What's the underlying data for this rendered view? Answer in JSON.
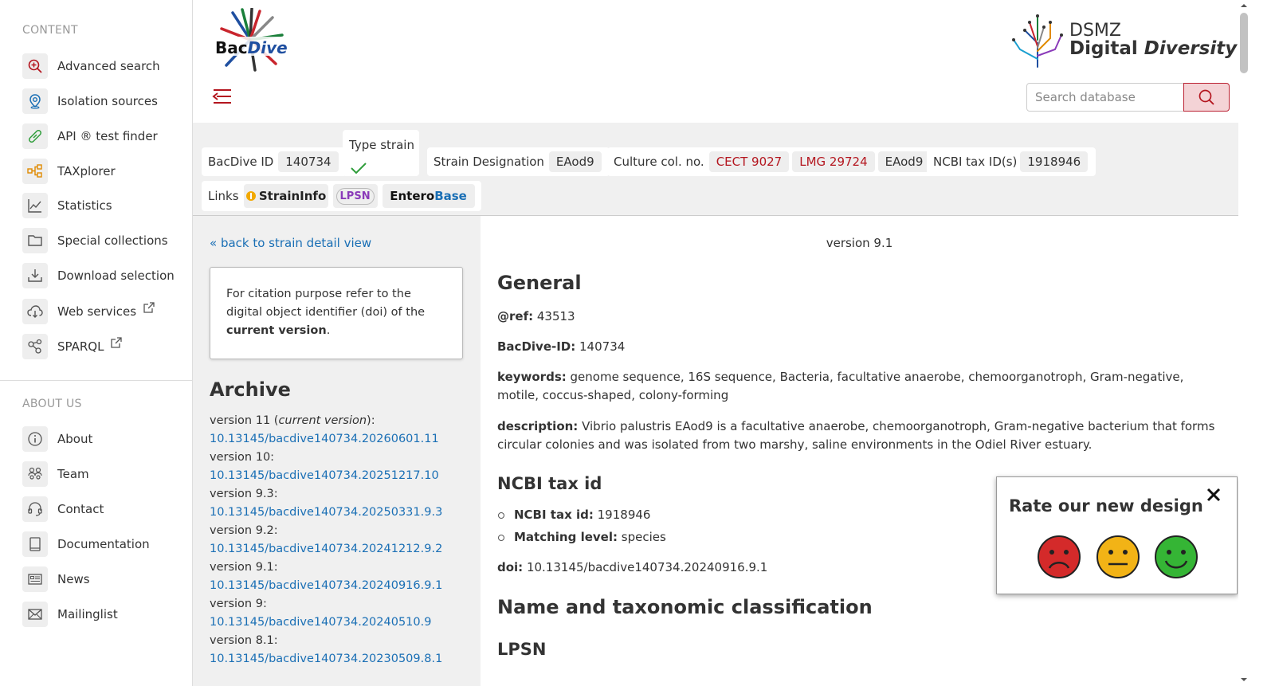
{
  "sidebar": {
    "content_heading": "CONTENT",
    "content_items": [
      {
        "label": "Advanced search",
        "icon": "search-plus-icon"
      },
      {
        "label": "Isolation sources",
        "icon": "map-pin-icon"
      },
      {
        "label": "API ® test finder",
        "icon": "test-tube-icon"
      },
      {
        "label": "TAXplorer",
        "icon": "tree-icon"
      },
      {
        "label": "Statistics",
        "icon": "line-chart-icon"
      },
      {
        "label": "Special collections",
        "icon": "folder-icon"
      },
      {
        "label": "Download selection",
        "icon": "download-icon"
      },
      {
        "label": "Web services",
        "icon": "cloud-download-icon",
        "external": true
      },
      {
        "label": "SPARQL",
        "icon": "share-nodes-icon",
        "external": true
      }
    ],
    "about_heading": "ABOUT US",
    "about_items": [
      {
        "label": "About",
        "icon": "info-icon"
      },
      {
        "label": "Team",
        "icon": "team-icon"
      },
      {
        "label": "Contact",
        "icon": "headset-icon"
      },
      {
        "label": "Documentation",
        "icon": "book-icon"
      },
      {
        "label": "News",
        "icon": "newspaper-icon"
      },
      {
        "label": "Mailinglist",
        "icon": "mail-icon"
      }
    ]
  },
  "header": {
    "logo_prefix": "Bac",
    "logo_suffix": "Dive",
    "dsmz_line1": "DSMZ",
    "dsmz_line2a": "Digital ",
    "dsmz_line2b": "Diversity",
    "search_placeholder": "Search database"
  },
  "infobar": {
    "bacdive_id_label": "BacDive ID",
    "bacdive_id": "140734",
    "type_strain_label": "Type strain",
    "strain_designation_label": "Strain Designation",
    "strain_designation": "EAod9",
    "culture_label": "Culture col. no.",
    "culture_numbers": [
      "CECT 9027",
      "LMG 29724",
      "EAod9"
    ],
    "ncbi_label": "NCBI tax ID(s)",
    "ncbi_id": "1918946",
    "links_label": "Links",
    "link_straininfo": "StrainInfo",
    "link_lpsn": "LPSN",
    "link_entero_a": "Entero",
    "link_entero_b": "Base"
  },
  "left": {
    "back_link": "« back to strain detail view",
    "cite_text_1": "For citation purpose refer to the digital object identifier (doi) of the ",
    "cite_bold": "current version",
    "cite_end": ".",
    "archive_title": "Archive",
    "archive": [
      {
        "version": "version 11 (",
        "current": "current version",
        "suffix": "):",
        "doi": "10.13145/bacdive140734.20260601.11"
      },
      {
        "version": "version 10:",
        "current": "",
        "suffix": "",
        "doi": "10.13145/bacdive140734.20251217.10"
      },
      {
        "version": "version 9.3:",
        "current": "",
        "suffix": "",
        "doi": "10.13145/bacdive140734.20250331.9.3"
      },
      {
        "version": "version 9.2:",
        "current": "",
        "suffix": "",
        "doi": "10.13145/bacdive140734.20241212.9.2"
      },
      {
        "version": "version 9.1:",
        "current": "",
        "suffix": "",
        "doi": "10.13145/bacdive140734.20240916.9.1"
      },
      {
        "version": "version 9:",
        "current": "",
        "suffix": "",
        "doi": "10.13145/bacdive140734.20240510.9"
      },
      {
        "version": "version 8.1:",
        "current": "",
        "suffix": "",
        "doi": "10.13145/bacdive140734.20230509.8.1"
      }
    ]
  },
  "main": {
    "version_label": "version 9.1",
    "general_title": "General",
    "ref_label": "@ref:",
    "ref_value": " 43513",
    "bacdive_label": "BacDive-ID:",
    "bacdive_value": " 140734",
    "keywords_label": "keywords:",
    "keywords_value": " genome sequence, 16S sequence, Bacteria, facultative anaerobe, chemoorganotroph, Gram-negative, motile, coccus-shaped, colony-forming",
    "description_label": "description:",
    "description_value": " Vibrio palustris EAod9 is a facultative anaerobe, chemoorganotroph, Gram-negative bacterium that forms circular colonies and was isolated from two marshy, saline environments in the Odiel River estuary.",
    "ncbi_title": "NCBI tax id",
    "ncbi_tax_label": "NCBI tax id:",
    "ncbi_tax_value": " 1918946",
    "matching_label": "Matching level:",
    "matching_value": " species",
    "doi_label": "doi:",
    "doi_value": " 10.13145/bacdive140734.20240916.9.1",
    "name_title": "Name and taxonomic classification",
    "lpsn_title": "LPSN"
  },
  "rate": {
    "title": "Rate our new design"
  },
  "colors": {
    "accent_red": "#b4161f",
    "link_blue": "#1a6fb5",
    "panel_gray": "#f0f0f0"
  }
}
